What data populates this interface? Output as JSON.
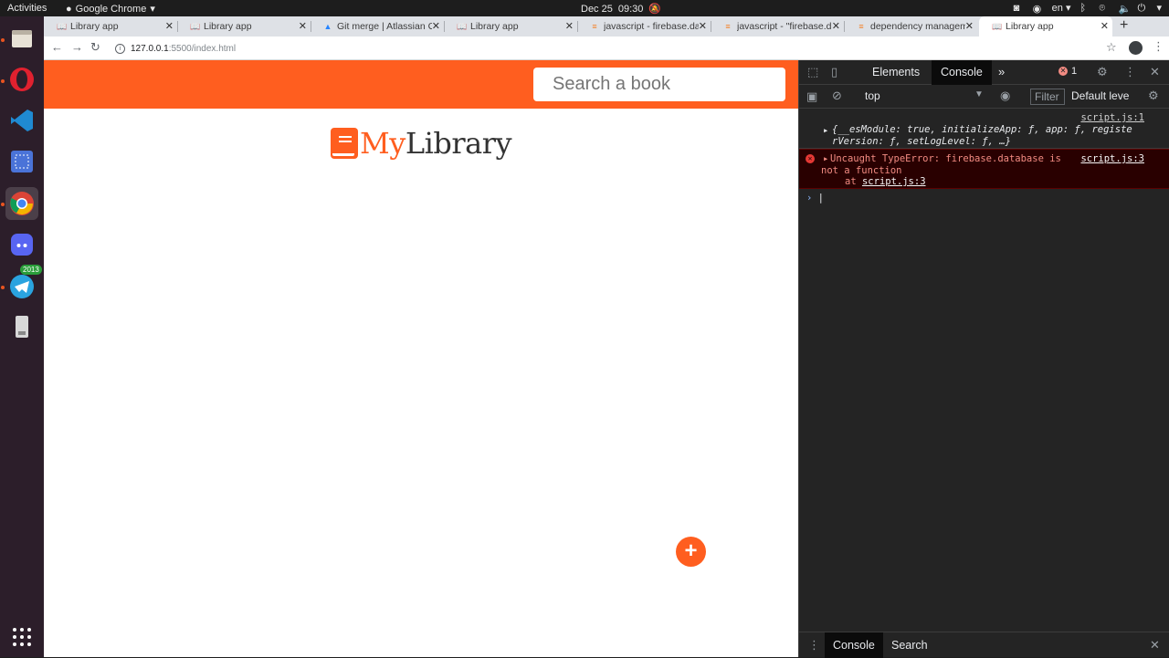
{
  "system": {
    "activities": "Activities",
    "app_name": "Google Chrome",
    "date": "Dec 25",
    "time": "09:30",
    "lang": "en"
  },
  "dock": {
    "telegram_badge": "2013"
  },
  "tabs": [
    {
      "title": "Library app",
      "favicon": "📖"
    },
    {
      "title": "Library app",
      "favicon": "📖"
    },
    {
      "title": "Git merge | Atlassian G",
      "favicon": "▲"
    },
    {
      "title": "Library app",
      "favicon": "📖"
    },
    {
      "title": "javascript - firebase.da",
      "favicon": "≡"
    },
    {
      "title": "javascript - \"firebase.d",
      "favicon": "≡"
    },
    {
      "title": "dependency managem",
      "favicon": "≡"
    },
    {
      "title": "Library app",
      "favicon": "📖"
    }
  ],
  "address": {
    "host": "127.0.0.1",
    "path": ":5500/index.html"
  },
  "app": {
    "search_placeholder": "Search a book",
    "logo_my": "My",
    "logo_library": "Library",
    "fab_label": "+"
  },
  "devtools": {
    "tab_elements": "Elements",
    "tab_console": "Console",
    "more": "»",
    "error_count": "1",
    "context": "top",
    "filter": "Filter",
    "levels": "Default leve",
    "log1_src": "script.js:1",
    "log1_line1": "{__esModule: true, initializeApp: ƒ, app: ƒ, registe",
    "log1_line2": "rVersion: ƒ, setLogLevel: ƒ, …}",
    "err_src": "script.js:3",
    "err_line1": "Uncaught TypeError: firebase.database is",
    "err_line2": "not a function",
    "err_at": "at",
    "err_at_src": "script.js:3",
    "drawer_console": "Console",
    "drawer_search": "Search"
  }
}
